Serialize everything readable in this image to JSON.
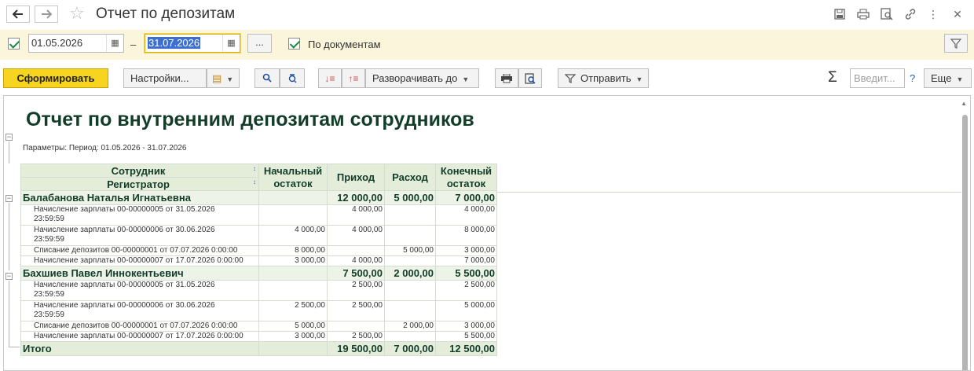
{
  "window": {
    "title": "Отчет по депозитам",
    "back_icon": "arrow-left-icon",
    "forward_icon": "arrow-right-icon",
    "favorite_icon": "star-icon",
    "right_icons": [
      "save-icon",
      "print-icon",
      "preview-icon",
      "link-icon",
      "more-vertical-icon",
      "close-icon"
    ]
  },
  "params": {
    "period_from": "01.05.2026",
    "period_to": "31.07.2026",
    "dash": "–",
    "ellipsis": "...",
    "by_documents_label": "По документам",
    "by_documents_checked": true,
    "period_checked": true
  },
  "toolbar": {
    "generate": "Сформировать",
    "settings": "Настройки...",
    "expand_to": "Разворачивать до",
    "send": "Отправить",
    "search_placeholder": "Введит...",
    "help": "?",
    "more": "Еще",
    "sum_icon": "Σ"
  },
  "report": {
    "title": "Отчет по внутренним депозитам сотрудников",
    "parameters": "Параметры:   Период: 01.05.2026 - 31.07.2026",
    "headers": {
      "employee": "Сотрудник",
      "registrar": "Регистратор",
      "opening": [
        "Начальный",
        "остаток"
      ],
      "income": "Приход",
      "expense": "Расход",
      "closing": [
        "Конечный",
        "остаток"
      ]
    },
    "groups": [
      {
        "name": "Балабанова Наталья Игнатьевна",
        "opening": "",
        "income": "12 000,00",
        "expense": "5 000,00",
        "closing": "7 000,00",
        "rows": [
          {
            "doc": "Начисление зарплаты 00-00000005 от 31.05.2026",
            "doc2": "23:59:59",
            "opening": "",
            "income": "4 000,00",
            "expense": "",
            "closing": "4 000,00"
          },
          {
            "doc": "Начисление зарплаты 00-00000006 от 30.06.2026",
            "doc2": "23:59:59",
            "opening": "4 000,00",
            "income": "4 000,00",
            "expense": "",
            "closing": "8 000,00"
          },
          {
            "doc": "Списание депозитов 00-00000001 от 07.07.2026 0:00:00",
            "doc2": "",
            "opening": "8 000,00",
            "income": "",
            "expense": "5 000,00",
            "closing": "3 000,00"
          },
          {
            "doc": "Начисление зарплаты 00-00000007 от 17.07.2026 0:00:00",
            "doc2": "",
            "opening": "3 000,00",
            "income": "4 000,00",
            "expense": "",
            "closing": "7 000,00"
          }
        ]
      },
      {
        "name": "Бахшиев Павел Иннокентьевич",
        "opening": "",
        "income": "7 500,00",
        "expense": "2 000,00",
        "closing": "5 500,00",
        "rows": [
          {
            "doc": "Начисление зарплаты 00-00000005 от 31.05.2026",
            "doc2": "23:59:59",
            "opening": "",
            "income": "2 500,00",
            "expense": "",
            "closing": "2 500,00"
          },
          {
            "doc": "Начисление зарплаты 00-00000006 от 30.06.2026",
            "doc2": "23:59:59",
            "opening": "2 500,00",
            "income": "2 500,00",
            "expense": "",
            "closing": "5 000,00"
          },
          {
            "doc": "Списание депозитов 00-00000001 от 07.07.2026 0:00:00",
            "doc2": "",
            "opening": "5 000,00",
            "income": "",
            "expense": "2 000,00",
            "closing": "3 000,00"
          },
          {
            "doc": "Начисление зарплаты 00-00000007 от 17.07.2026 0:00:00",
            "doc2": "",
            "opening": "3 000,00",
            "income": "2 500,00",
            "expense": "",
            "closing": "5 500,00"
          }
        ]
      }
    ],
    "total": {
      "label": "Итого",
      "opening": "",
      "income": "19 500,00",
      "expense": "7 000,00",
      "closing": "12 500,00"
    }
  },
  "colors": {
    "accent_button": "#f7d41f",
    "param_bar": "#fbf5dc",
    "report_heading": "#123d29",
    "header_fill": "#e4ecda"
  }
}
